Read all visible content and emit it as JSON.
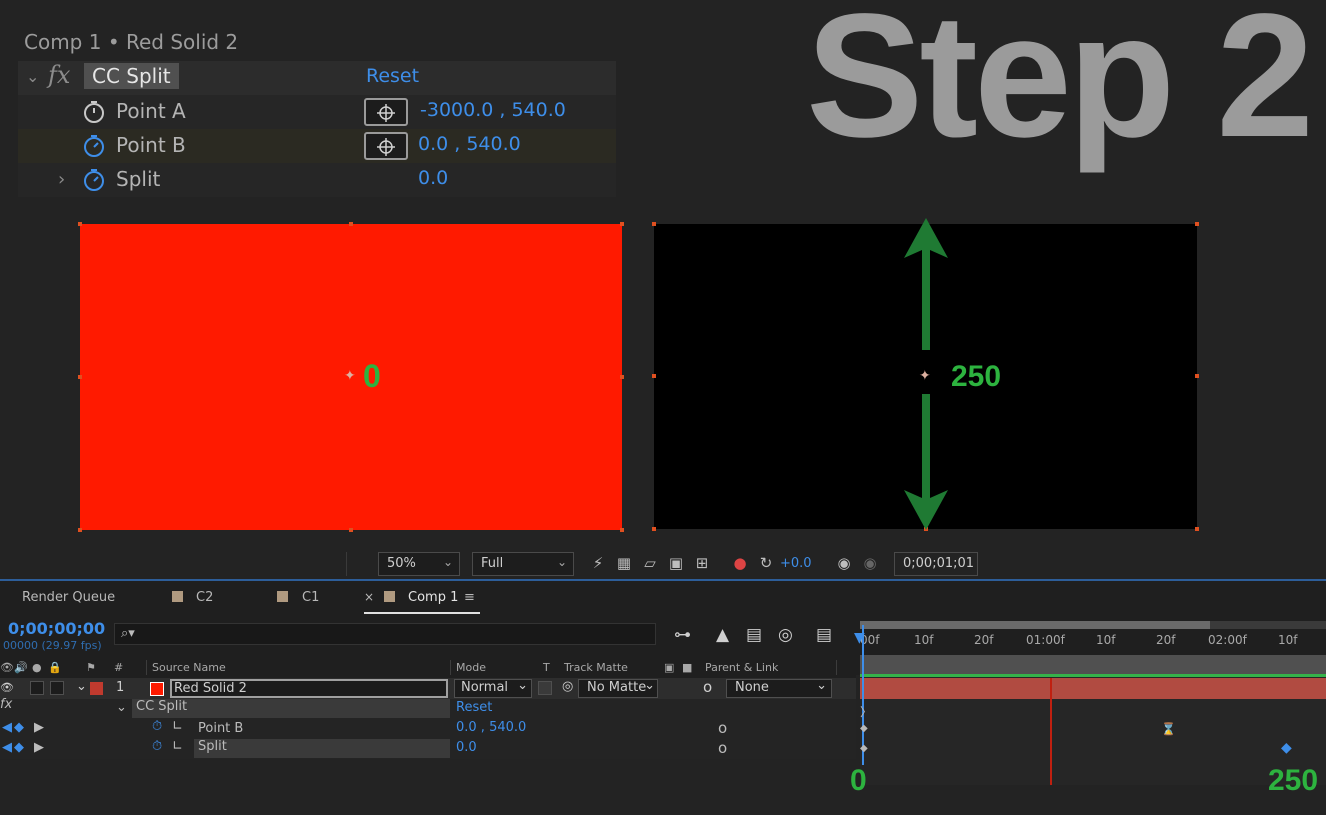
{
  "effect_controls": {
    "title": "Comp 1 • Red Solid 2",
    "fx_label": "fx",
    "effect_name": "CC Split",
    "reset_label": "Reset",
    "props": [
      {
        "label": "Point A",
        "value": "-3000.0 , 540.0"
      },
      {
        "label": "Point B",
        "value": "0.0 , 540.0"
      },
      {
        "label": "Split",
        "value": "0.0"
      }
    ]
  },
  "overlay": {
    "step_text": "Step 2",
    "left_value": "0",
    "right_value": "250",
    "timeline_start_value": "0",
    "timeline_end_value": "250",
    "colors": {
      "annotation_green": "#2db33f",
      "arrow_green": "#1f7a33",
      "solid_red": "#ff1a00"
    }
  },
  "viewer_toolbar": {
    "zoom": "50%",
    "resolution": "Full",
    "exposure": "+0.0",
    "timecode": "0;00;01;01"
  },
  "timeline": {
    "tabs": [
      "Render Queue",
      "C2",
      "C1",
      "Comp 1"
    ],
    "current_time": "0;00;00;00",
    "frame_info": "00000 (29.97 fps)",
    "search_placeholder": "⌕▾",
    "columns": {
      "num": "#",
      "source_name": "Source Name",
      "mode": "Mode",
      "t": "T",
      "track_matte": "Track Matte",
      "parent": "Parent & Link"
    },
    "layer": {
      "index": "1",
      "name": "Red Solid 2",
      "mode": "Normal",
      "matte": "No Matte",
      "parent": "None"
    },
    "effect_row": {
      "fx": "fx",
      "name": "CC Split",
      "reset": "Reset"
    },
    "prop_rows": [
      {
        "name": "Point B",
        "value": "0.0 , 540.0"
      },
      {
        "name": "Split",
        "value": "0.0"
      }
    ],
    "ruler_labels": [
      "00f",
      "10f",
      "20f",
      "01:00f",
      "10f",
      "20f",
      "02:00f",
      "10f"
    ],
    "accent_blue": "#3e8ee9"
  }
}
